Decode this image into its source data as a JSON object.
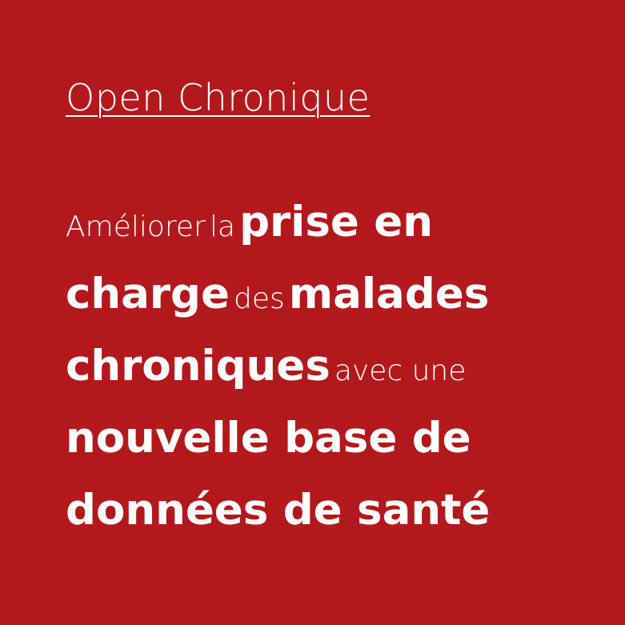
{
  "background_color": "#b3191c",
  "text_color": "#ffffff",
  "title": "Open Chronique",
  "tagline": {
    "line1": {
      "w1": "Améliorer",
      "w2": "la",
      "w3": "prise en"
    },
    "line2": {
      "w1": "charge",
      "w2": "des",
      "w3": "malades"
    },
    "line3": {
      "w1": "chroniques",
      "w2": "avec une"
    },
    "line4": {
      "w1": "nouvelle base de"
    },
    "line5": {
      "w1": "données de santé"
    }
  }
}
